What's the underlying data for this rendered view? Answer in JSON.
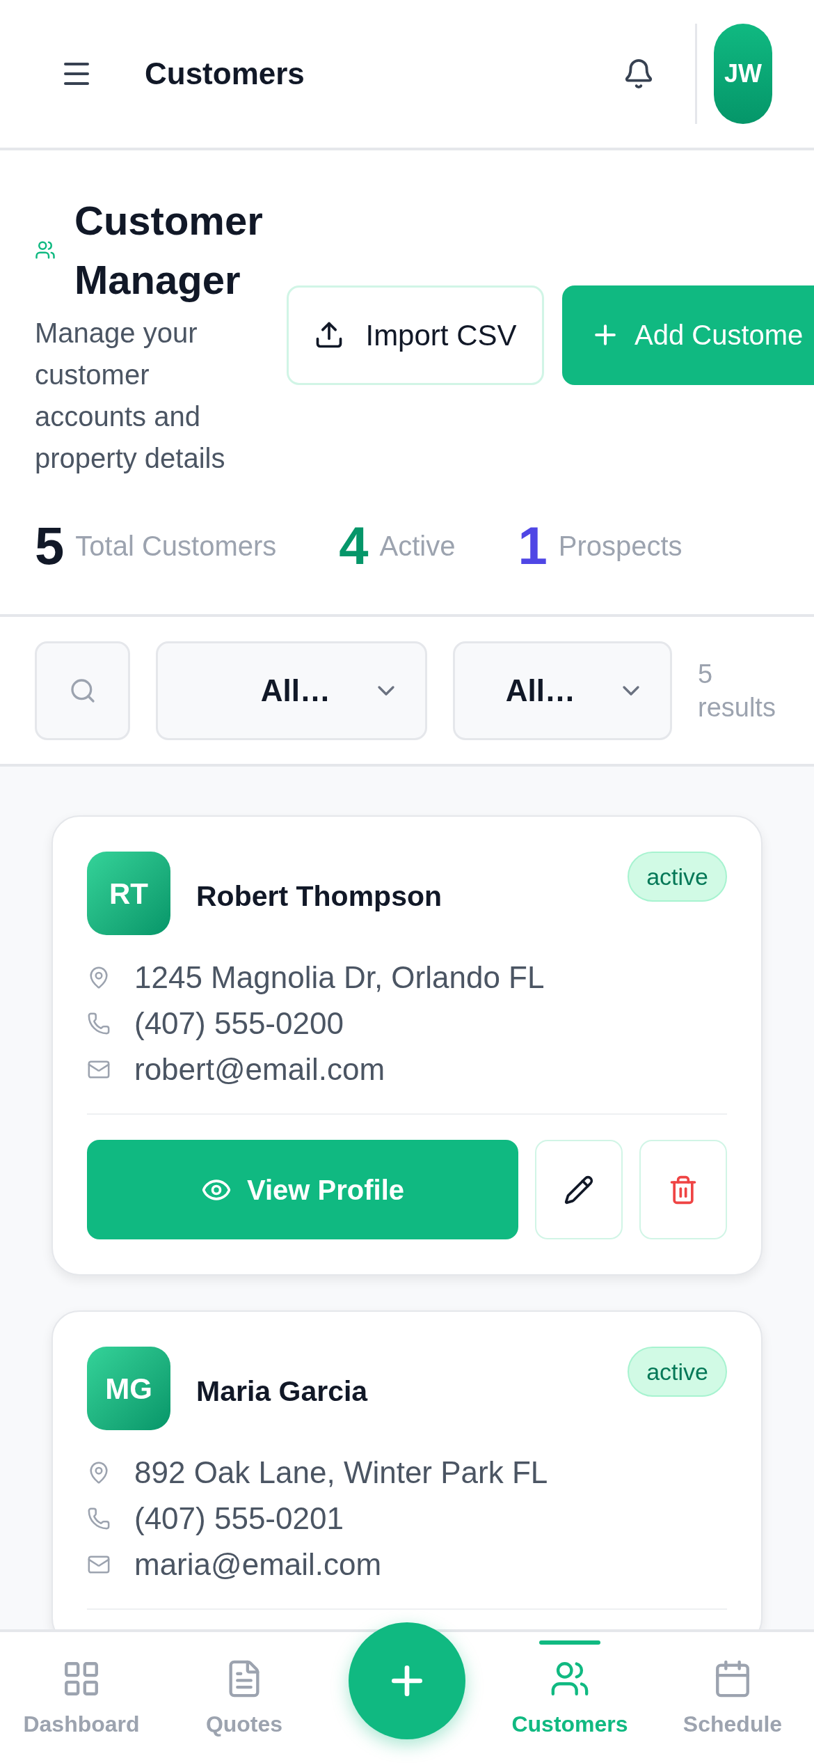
{
  "header": {
    "title": "Customers",
    "avatar": "JW"
  },
  "page": {
    "title": "Customer Manager",
    "description": "Manage your customer accounts and property details",
    "buttons": [
      {
        "kind": "import",
        "label": "Import CSV"
      },
      {
        "kind": "add",
        "label": "Add Custome"
      }
    ]
  },
  "stats": [
    {
      "value": "5",
      "label": "Total Customers",
      "color": "#111827"
    },
    {
      "value": "4",
      "label": "Active",
      "color": "#059669"
    },
    {
      "value": "1",
      "label": "Prospects",
      "color": "#4f46e5"
    }
  ],
  "filters": {
    "selects": [
      "All…",
      "All…"
    ],
    "results": "5 results"
  },
  "customers": [
    {
      "initials": "RT",
      "name": "Robert Thompson",
      "status": "active",
      "address": "1245 Magnolia Dr, Orlando FL",
      "phone": "(407) 555-0200",
      "email": "robert@email.com",
      "actions": [
        {
          "kind": "view",
          "label": "View Profile"
        },
        {
          "kind": "edit"
        },
        {
          "kind": "delete"
        }
      ]
    },
    {
      "initials": "MG",
      "name": "Maria Garcia",
      "status": "active",
      "address": "892 Oak Lane, Winter Park FL",
      "phone": "(407) 555-0201",
      "email": "maria@email.com"
    }
  ],
  "nav": [
    {
      "kind": "dashboard",
      "label": "Dashboard",
      "selected": false
    },
    {
      "kind": "quotes",
      "label": "Quotes",
      "selected": false
    },
    {
      "kind": "fab"
    },
    {
      "kind": "customers",
      "label": "Customers",
      "selected": true
    },
    {
      "kind": "schedule",
      "label": "Schedule",
      "selected": false
    }
  ]
}
